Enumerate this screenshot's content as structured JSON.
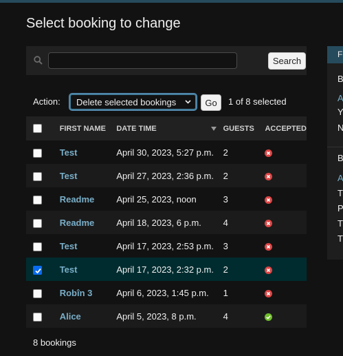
{
  "page": {
    "title": "Select booking to change"
  },
  "search": {
    "value": "",
    "placeholder": "",
    "button_label": "Search"
  },
  "actions": {
    "label": "Action:",
    "selected": "Delete selected bookings",
    "go_label": "Go",
    "selection_status": "1 of 8 selected"
  },
  "table": {
    "headers": [
      "First name",
      "Date time",
      "Guests",
      "Accepted"
    ],
    "rows": [
      {
        "first_name": "Test",
        "date_time": "April 30, 2023, 5:27 p.m.",
        "guests": "2",
        "accepted": false,
        "selected": false
      },
      {
        "first_name": "Test",
        "date_time": "April 27, 2023, 2:36 p.m.",
        "guests": "2",
        "accepted": false,
        "selected": false
      },
      {
        "first_name": "Readme",
        "date_time": "April 25, 2023, noon",
        "guests": "3",
        "accepted": false,
        "selected": false
      },
      {
        "first_name": "Readme",
        "date_time": "April 18, 2023, 6 p.m.",
        "guests": "4",
        "accepted": false,
        "selected": false
      },
      {
        "first_name": "Test",
        "date_time": "April 17, 2023, 2:53 p.m.",
        "guests": "3",
        "accepted": false,
        "selected": false
      },
      {
        "first_name": "Test",
        "date_time": "April 17, 2023, 2:32 p.m.",
        "guests": "2",
        "accepted": false,
        "selected": true
      },
      {
        "first_name": "Robîn 3",
        "date_time": "April 6, 2023, 1:45 p.m.",
        "guests": "1",
        "accepted": false,
        "selected": false
      },
      {
        "first_name": "Alice",
        "date_time": "April 5, 2023, 8 p.m.",
        "guests": "4",
        "accepted": true,
        "selected": false
      }
    ]
  },
  "footer": {
    "count": "8 bookings"
  },
  "filter": {
    "header": "F",
    "section1_title": "B",
    "section1_items": [
      "A",
      "Y",
      "N"
    ],
    "section2_title": "B",
    "section2_items": [
      "A",
      "T",
      "P",
      "T",
      "T"
    ]
  },
  "colors": {
    "background": "#121212",
    "link": "#79aec8",
    "header_bar": "#264b5d",
    "selected_row": "#002c2f",
    "status_no": "#dd4646",
    "status_yes": "#70bf2b"
  }
}
